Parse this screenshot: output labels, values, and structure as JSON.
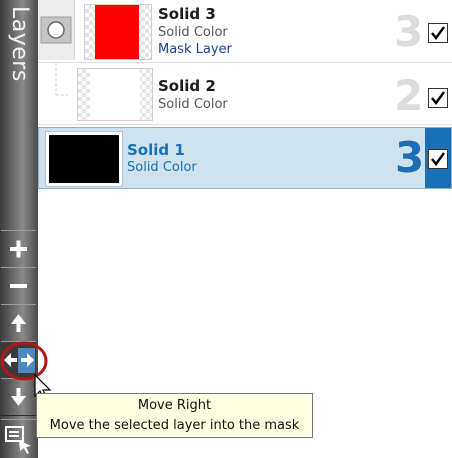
{
  "panel": {
    "title": "Layers"
  },
  "layers": [
    {
      "name": "Solid 3",
      "type": "Solid Color",
      "mask_label": "Mask Layer",
      "number": "3",
      "visible": true,
      "selected": false,
      "color": "#ff0000"
    },
    {
      "name": "Solid 2",
      "type": "Solid Color",
      "number": "2",
      "visible": true,
      "selected": false,
      "color": "#ffffff"
    },
    {
      "name": "Solid 1",
      "type": "Solid Color",
      "number": "3",
      "visible": true,
      "selected": true,
      "color": "#000000"
    }
  ],
  "toolbar": {
    "buttons": [
      {
        "icon": "plus-icon"
      },
      {
        "icon": "minus-icon"
      },
      {
        "icon": "arrow-up-icon"
      },
      {
        "icon": "arrow-left-right-icon"
      },
      {
        "icon": "arrow-down-icon"
      },
      {
        "icon": "layer-properties-icon"
      }
    ]
  },
  "tooltip": {
    "title": "Move Right",
    "description": "Move the selected layer into the mask"
  },
  "colors": {
    "selection": "#cfe2ef",
    "selected_text": "#1a6fb5",
    "accent": "#1a6fb5",
    "highlight_ring": "#b01818"
  }
}
